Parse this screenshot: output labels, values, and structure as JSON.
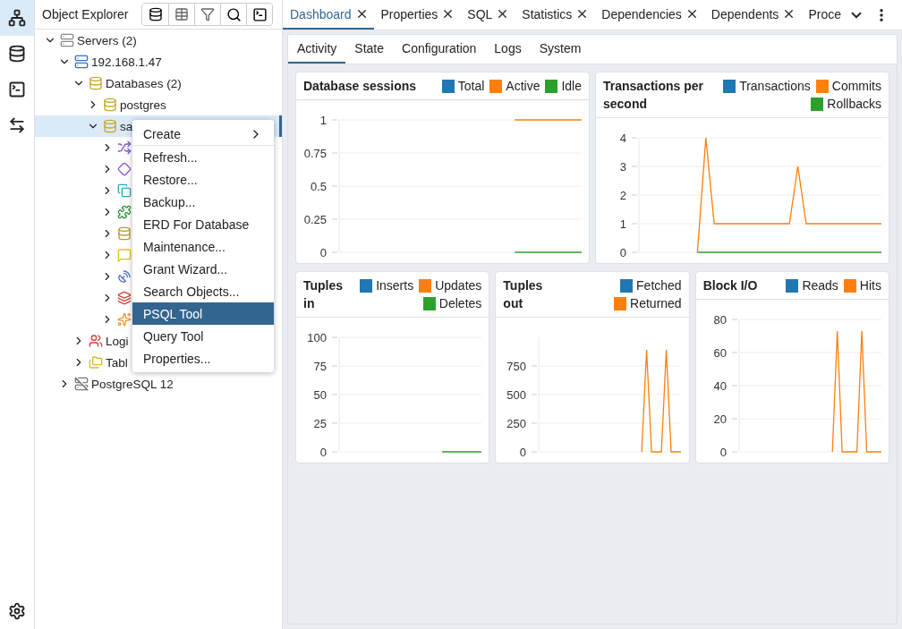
{
  "rail": {
    "items": [
      {
        "kind": "explorer",
        "selected": true
      },
      {
        "kind": "database",
        "selected": false
      },
      {
        "kind": "terminal",
        "selected": false
      },
      {
        "kind": "compare",
        "selected": false
      }
    ]
  },
  "explorer": {
    "title": "Object Explorer",
    "tree": [
      {
        "label": "Servers (2)",
        "kind": "servers",
        "expanded": true,
        "selected": false,
        "children": [
          {
            "label": "192.168.1.47",
            "kind": "pgserver",
            "expanded": true,
            "selected": false,
            "children": [
              {
                "label": "Databases (2)",
                "kind": "databases",
                "expanded": true,
                "selected": false,
                "children": [
                  {
                    "label": "postgres",
                    "kind": "database",
                    "expanded": false,
                    "selected": false
                  },
                  {
                    "label": "sa",
                    "kind": "database",
                    "expanded": true,
                    "selected": true,
                    "children": [
                      {
                        "kind": "casts",
                        "expanded": false,
                        "selected": false
                      },
                      {
                        "kind": "catalogs",
                        "expanded": false,
                        "selected": false
                      },
                      {
                        "kind": "event-triggers",
                        "expanded": false,
                        "selected": false
                      },
                      {
                        "kind": "extensions",
                        "expanded": false,
                        "selected": false
                      },
                      {
                        "kind": "wrappers",
                        "expanded": false,
                        "selected": false
                      },
                      {
                        "kind": "languages",
                        "expanded": false,
                        "selected": false
                      },
                      {
                        "kind": "publications",
                        "expanded": false,
                        "selected": false
                      },
                      {
                        "kind": "schemas",
                        "expanded": false,
                        "selected": false
                      },
                      {
                        "kind": "subscriptions",
                        "expanded": false,
                        "selected": false
                      }
                    ]
                  }
                ]
              },
              {
                "label": "Logi",
                "kind": "roles",
                "expanded": false,
                "selected": false
              },
              {
                "label": "Tabl",
                "kind": "tablespaces",
                "expanded": false,
                "selected": false
              }
            ]
          },
          {
            "label": "PostgreSQL 12",
            "kind": "disconnected",
            "expanded": false,
            "selected": false
          }
        ]
      }
    ]
  },
  "context_menu": [
    {
      "label": "Create",
      "kind": "submenu",
      "selected": false
    },
    {
      "label": "Refresh...",
      "kind": "item",
      "selected": false
    },
    {
      "label": "Restore...",
      "kind": "item",
      "selected": false
    },
    {
      "label": "Backup...",
      "kind": "item",
      "selected": false
    },
    {
      "label": "ERD For Database",
      "kind": "item",
      "selected": false
    },
    {
      "label": "Maintenance...",
      "kind": "item",
      "selected": false
    },
    {
      "label": "Grant Wizard...",
      "kind": "item",
      "selected": false
    },
    {
      "label": "Search Objects...",
      "kind": "item",
      "selected": false
    },
    {
      "label": "PSQL Tool",
      "kind": "item",
      "selected": true
    },
    {
      "label": "Query Tool",
      "kind": "item",
      "selected": false
    },
    {
      "label": "Properties...",
      "kind": "item",
      "selected": false
    }
  ],
  "tabs": [
    {
      "label": "Dashboard",
      "selected": true,
      "closable": true
    },
    {
      "label": "Properties",
      "selected": false,
      "closable": true
    },
    {
      "label": "SQL",
      "selected": false,
      "closable": true
    },
    {
      "label": "Statistics",
      "selected": false,
      "closable": true
    },
    {
      "label": "Dependencies",
      "selected": false,
      "closable": true
    },
    {
      "label": "Dependents",
      "selected": false,
      "closable": true
    },
    {
      "label": "Proce",
      "selected": false,
      "closable": false
    }
  ],
  "dashboard": {
    "tabs": [
      {
        "label": "Activity",
        "selected": true
      },
      {
        "label": "State",
        "selected": false
      },
      {
        "label": "Configuration",
        "selected": false
      },
      {
        "label": "Logs",
        "selected": false
      },
      {
        "label": "System",
        "selected": false
      }
    ],
    "charts": [
      {
        "chart_data": {
          "type": "line",
          "title": "Database sessions",
          "grid": true,
          "ylim": [
            0,
            1
          ],
          "yticks": [
            {
              "value": 0,
              "label": "0"
            },
            {
              "value": 0.25,
              "label": "0.25"
            },
            {
              "value": 0.5,
              "label": "0.5"
            },
            {
              "value": 0.75,
              "label": "0.75"
            },
            {
              "value": 1,
              "label": "1"
            }
          ],
          "series": [
            {
              "name": "Total",
              "color": "#1f77b4",
              "values": [
                null,
                null,
                null,
                null,
                null,
                null,
                null,
                null,
                null,
                null,
                null,
                null,
                null,
                null,
                null,
                null,
                null,
                null,
                null,
                null,
                null,
                null,
                null,
                null,
                null,
                null,
                null,
                null,
                null,
                null
              ]
            },
            {
              "name": "Active",
              "color": "#ff7f0e",
              "values": [
                null,
                null,
                null,
                null,
                null,
                null,
                null,
                null,
                null,
                null,
                null,
                null,
                null,
                null,
                null,
                null,
                null,
                null,
                null,
                null,
                null,
                1,
                1,
                1,
                1,
                1,
                1,
                1,
                1,
                1
              ]
            },
            {
              "name": "Idle",
              "color": "#2ca02c",
              "values": [
                null,
                null,
                null,
                null,
                null,
                null,
                null,
                null,
                null,
                null,
                null,
                null,
                null,
                null,
                null,
                null,
                null,
                null,
                null,
                null,
                null,
                0,
                0,
                0,
                0,
                0,
                0,
                0,
                0,
                0
              ]
            }
          ]
        }
      },
      {
        "chart_data": {
          "type": "line",
          "title": "Transactions per second",
          "grid": true,
          "ylim": [
            0,
            4
          ],
          "yticks": [
            0,
            1,
            2,
            3,
            4
          ],
          "series": [
            {
              "name": "Transactions",
              "color": "#1f77b4",
              "values": [
                null,
                null,
                null,
                null,
                null,
                null,
                null,
                null,
                null,
                null,
                null,
                null,
                null,
                null,
                null,
                null,
                null,
                null,
                null,
                null,
                null,
                null,
                null,
                null,
                null,
                null,
                null,
                null,
                null,
                null
              ]
            },
            {
              "name": "Commits",
              "color": "#ff7f0e",
              "values": [
                null,
                null,
                null,
                null,
                null,
                null,
                null,
                0,
                4,
                1,
                1,
                1,
                1,
                1,
                1,
                1,
                1,
                1,
                1,
                3,
                1,
                1,
                1,
                1,
                1,
                1,
                1,
                1,
                1,
                1
              ]
            },
            {
              "name": "Rollbacks",
              "color": "#2ca02c",
              "values": [
                null,
                null,
                null,
                null,
                null,
                null,
                null,
                0,
                0,
                0,
                0,
                0,
                0,
                0,
                0,
                0,
                0,
                0,
                0,
                0,
                0,
                0,
                0,
                0,
                0,
                0,
                0,
                0,
                0,
                0
              ]
            }
          ]
        }
      },
      {
        "chart_data": {
          "type": "line",
          "title": "Tuples in",
          "grid": true,
          "ylim": [
            0,
            100
          ],
          "yticks": [
            0,
            25,
            50,
            75,
            100
          ],
          "series": [
            {
              "name": "Inserts",
              "color": "#1f77b4",
              "values": [
                null,
                null,
                null,
                null,
                null,
                null,
                null,
                null,
                null,
                null,
                null,
                null,
                null,
                null,
                null,
                null,
                null,
                null,
                null,
                null,
                null,
                null,
                null,
                null,
                null,
                null,
                null,
                null,
                null,
                null
              ]
            },
            {
              "name": "Updates",
              "color": "#ff7f0e",
              "values": [
                null,
                null,
                null,
                null,
                null,
                null,
                null,
                null,
                null,
                null,
                null,
                null,
                null,
                null,
                null,
                null,
                null,
                null,
                null,
                null,
                null,
                null,
                null,
                null,
                null,
                null,
                null,
                null,
                null,
                null
              ]
            },
            {
              "name": "Deletes",
              "color": "#2ca02c",
              "values": [
                null,
                null,
                null,
                null,
                null,
                null,
                null,
                null,
                null,
                null,
                null,
                null,
                null,
                null,
                null,
                null,
                null,
                null,
                null,
                null,
                null,
                0,
                0,
                0,
                0,
                0,
                0,
                0,
                0,
                0
              ]
            }
          ]
        }
      },
      {
        "chart_data": {
          "type": "line",
          "title": "Tuples out",
          "grid": true,
          "ylim": [
            0,
            1000
          ],
          "yticks": [
            0,
            250,
            500,
            750
          ],
          "series": [
            {
              "name": "Fetched",
              "color": "#1f77b4",
              "values": [
                null,
                null,
                null,
                null,
                null,
                null,
                null,
                null,
                null,
                null,
                null,
                null,
                null,
                null,
                null,
                null,
                null,
                null,
                null,
                null,
                null,
                null,
                null,
                null,
                null,
                null,
                null,
                null,
                null,
                null
              ]
            },
            {
              "name": "Returned",
              "color": "#ff7f0e",
              "values": [
                null,
                null,
                null,
                null,
                null,
                null,
                null,
                null,
                null,
                null,
                null,
                null,
                null,
                null,
                null,
                null,
                null,
                null,
                null,
                null,
                null,
                0,
                890,
                0,
                0,
                0,
                890,
                0,
                0,
                0
              ]
            }
          ]
        }
      },
      {
        "chart_data": {
          "type": "line",
          "title": "Block I/O",
          "grid": true,
          "ylim": [
            0,
            80
          ],
          "yticks": [
            0,
            20,
            40,
            60,
            80
          ],
          "series": [
            {
              "name": "Reads",
              "color": "#1f77b4",
              "values": [
                null,
                null,
                null,
                null,
                null,
                null,
                null,
                null,
                null,
                null,
                null,
                null,
                null,
                null,
                null,
                null,
                null,
                null,
                null,
                null,
                null,
                null,
                null,
                null,
                null,
                null,
                null,
                null,
                null,
                null
              ]
            },
            {
              "name": "Hits",
              "color": "#ff7f0e",
              "values": [
                null,
                null,
                null,
                null,
                null,
                null,
                null,
                null,
                null,
                null,
                null,
                null,
                null,
                null,
                null,
                null,
                null,
                null,
                null,
                0,
                73,
                0,
                0,
                0,
                0,
                73,
                0,
                0,
                0,
                0
              ]
            }
          ]
        }
      }
    ]
  }
}
